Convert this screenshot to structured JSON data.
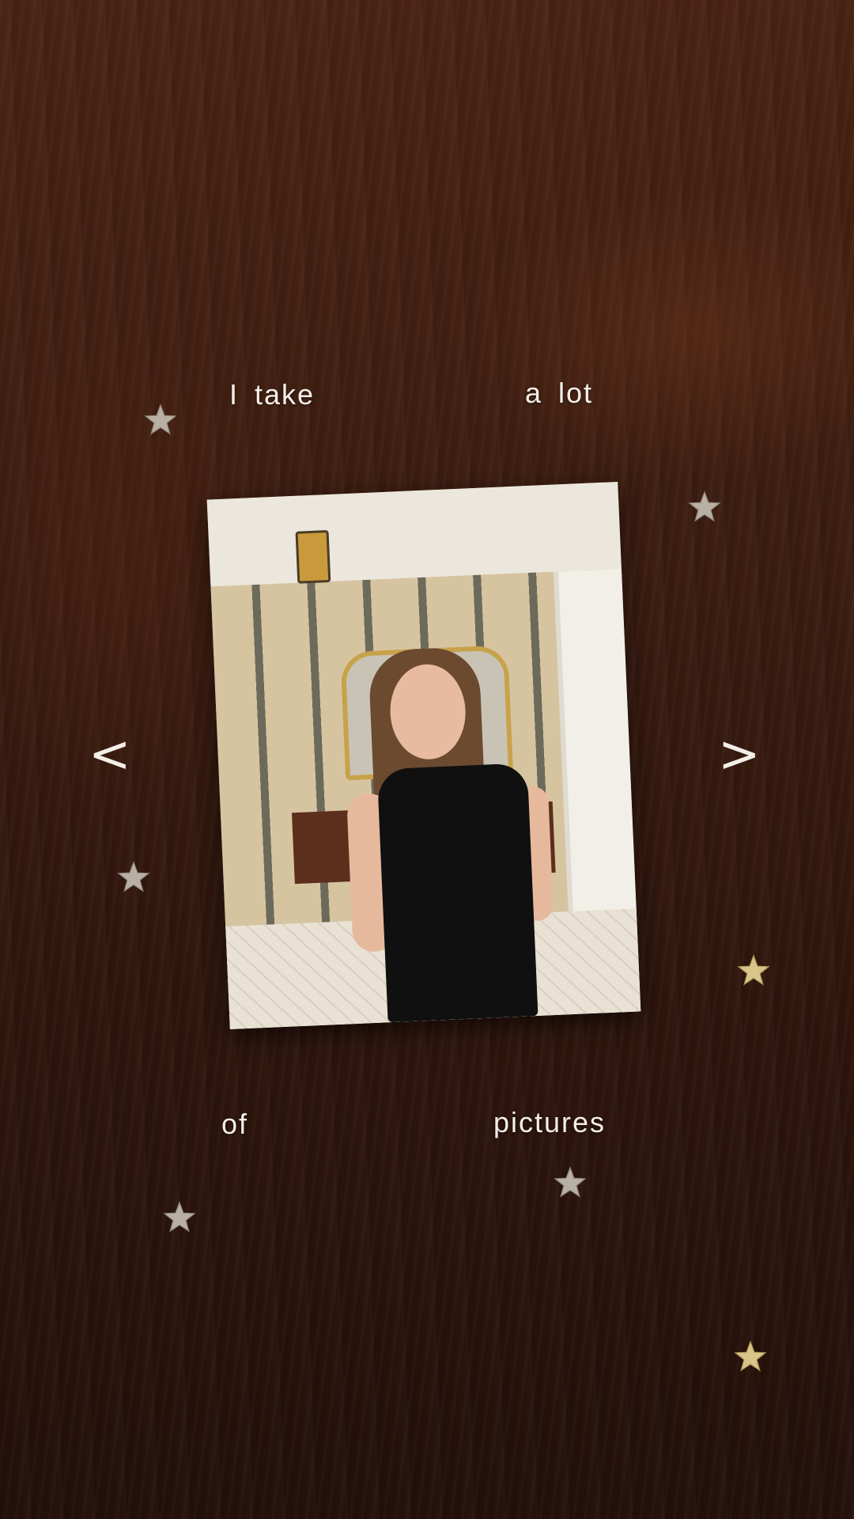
{
  "story": {
    "words": {
      "w1": "I take",
      "w2": "a lot",
      "w3": "of",
      "w4": "pictures"
    },
    "nav": {
      "prev": "<",
      "next": ">"
    },
    "photo_description_icon": "photo-card",
    "star_color": "#d9c48a"
  }
}
